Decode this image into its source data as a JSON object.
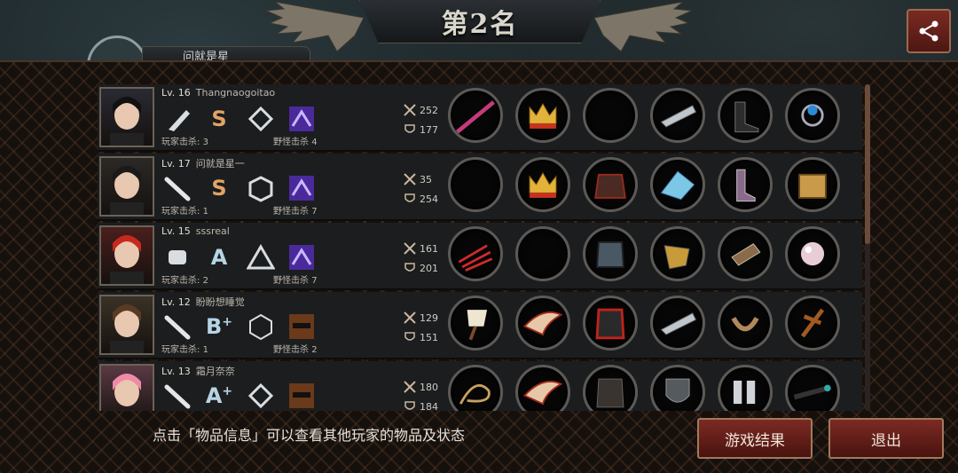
{
  "header": {
    "title": "第2名",
    "tab_label": "问就是星"
  },
  "labels": {
    "player_kills": "玩家击杀",
    "monster_kills": "野怪击杀"
  },
  "players": [
    {
      "level": "Lv. 16",
      "name": "Thangnaogoitao",
      "weapon": "knife-icon",
      "grade": "S",
      "grade_sup": "",
      "class": "diamond-emblem-icon",
      "pet": "purple-dragon-icon",
      "player_kills": "3",
      "monster_kills": "4",
      "attack": "252",
      "defense": "177",
      "items": [
        "pink-sword-icon",
        "crown-icon",
        "empty-slot",
        "spiked-gauntlet-icon",
        "black-boots-icon",
        "sapphire-ring-icon"
      ]
    },
    {
      "level": "Lv. 17",
      "name": "问就是星一",
      "weapon": "bat-icon",
      "grade": "S",
      "grade_sup": "",
      "class": "cube-emblem-icon",
      "pet": "purple-dragon-icon",
      "player_kills": "1",
      "monster_kills": "7",
      "attack": "35",
      "defense": "254",
      "items": [
        "empty-slot",
        "crown-icon",
        "dark-armor-icon",
        "crystal-gauntlet-icon",
        "purple-boots-icon",
        "treasure-chest-icon"
      ]
    },
    {
      "level": "Lv. 15",
      "name": "sssreal",
      "weapon": "fist-icon",
      "grade": "A",
      "grade_sup": "",
      "class": "triangle-emblem-icon",
      "pet": "purple-dragon-icon",
      "player_kills": "2",
      "monster_kills": "7",
      "attack": "161",
      "defense": "201",
      "items": [
        "red-claw-icon",
        "empty-slot",
        "steel-armor-icon",
        "gold-gauntlet-icon",
        "bracer-icon",
        "pearl-icon"
      ]
    },
    {
      "level": "Lv. 12",
      "name": "盼盼想睡觉",
      "weapon": "bat-icon",
      "grade": "B",
      "grade_sup": "+",
      "class": "hexagon-emblem-icon",
      "pet": "masked-face-icon",
      "player_kills": "1",
      "monster_kills": "2",
      "attack": "129",
      "defense": "151",
      "items": [
        "white-axe-icon",
        "winged-tiara-icon",
        "red-armor-icon",
        "spiked-gauntlet-icon",
        "horseshoe-icon",
        "cross-icon"
      ]
    },
    {
      "level": "Lv. 13",
      "name": "霜月奈奈",
      "weapon": "bat-icon",
      "grade": "A",
      "grade_sup": "+",
      "class": "diamond-emblem-icon",
      "pet": "masked-face-icon",
      "player_kills": "",
      "monster_kills": "",
      "attack": "180",
      "defense": "184",
      "items": [
        "whip-icon",
        "winged-tiara-icon",
        "leather-armor-icon",
        "shield-icon",
        "knee-guards-icon",
        "scope-icon"
      ]
    }
  ],
  "footer": {
    "hint": "点击「物品信息」可以查看其他玩家的物品及状态",
    "result_button": "游戏结果",
    "exit_button": "退出"
  },
  "colors": {
    "accent_button": "#7c2a24",
    "grade_gold": "#e0a466",
    "grade_blue": "#b7d4e6"
  }
}
